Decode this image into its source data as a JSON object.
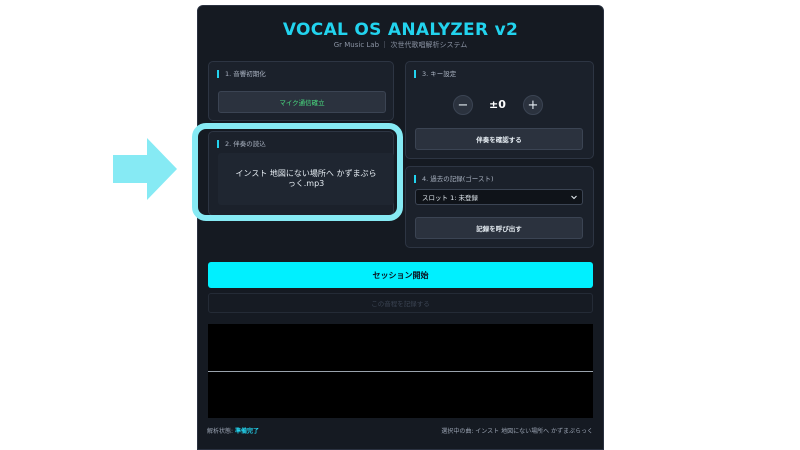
{
  "app": {
    "title": "VOCAL OS ANALYZER v2",
    "subtitle": "Gr Music Lab ｜ 次世代歌唱解析システム"
  },
  "section1": {
    "label": "1. 音響初期化",
    "button": "マイク通信確立"
  },
  "section2": {
    "label": "2. 伴奏の読込",
    "file_name": "インスト 地図にない場所へ かずまぷらっく.mp3"
  },
  "section3": {
    "label": "3. キー設定",
    "minus": "−",
    "value": "±0",
    "plus": "+",
    "button": "伴奏を確認する"
  },
  "section4": {
    "label": "4. 過去の記録(ゴースト)",
    "selected_slot": "スロット 1: 未登録",
    "button": "記録を呼び出す"
  },
  "actions": {
    "start": "セッション開始",
    "save": "この音程を記録する"
  },
  "status": {
    "label": "解析状態:",
    "value": "準備完了",
    "selected": "選択中の曲: インスト 地図にない場所へ かずまぷらっく"
  },
  "colors": {
    "accent": "#22d3ee",
    "start_button": "#00f0ff",
    "highlight": "#86eaf4",
    "mic_text": "#4ade80"
  }
}
